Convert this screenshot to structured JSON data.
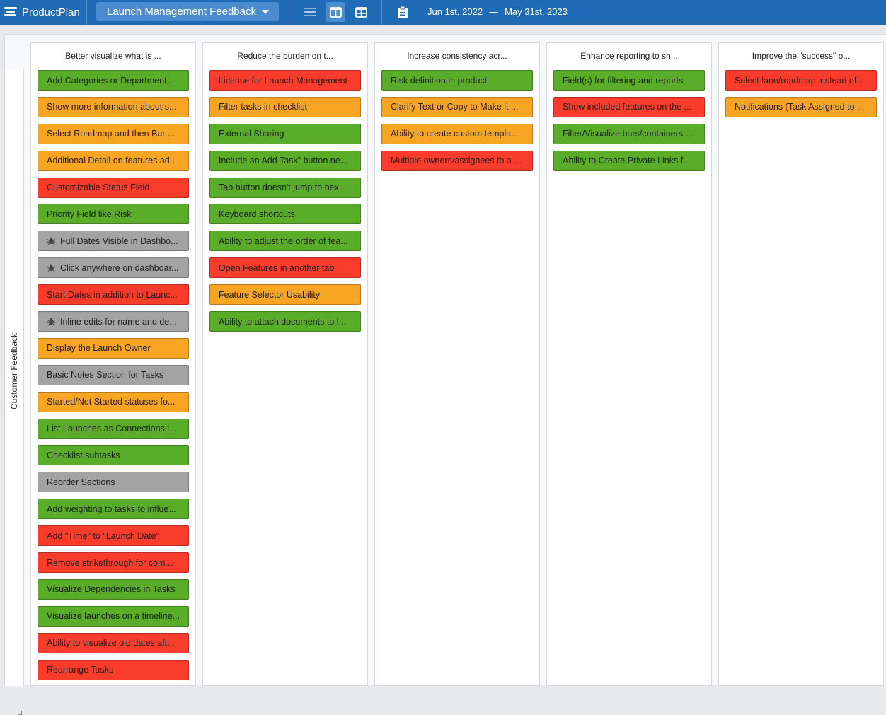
{
  "header": {
    "app_name": "ProductPlan",
    "roadmap_name": "Launch Management Feedback",
    "date_start": "Jun 1st, 2022",
    "date_separator": "—",
    "date_end": "May 31st, 2023",
    "icons": [
      "productplan-logo-icon",
      "dropdown-caret-icon",
      "list-view-icon",
      "board-view-icon",
      "table-view-icon",
      "clipboard-icon"
    ]
  },
  "lane": {
    "label": "Customer Feedback"
  },
  "colors": {
    "green": "#5aad28",
    "orange": "#f9a524",
    "red": "#fa3c2c",
    "gray": "#a3a3a3",
    "header": "#1f6bb5"
  },
  "columns": [
    {
      "title": "Better visualize what is ...",
      "cards": [
        {
          "label": "Add Categories or Department...",
          "color": "green"
        },
        {
          "label": "Show more information about s...",
          "color": "orange"
        },
        {
          "label": "Select Roadmap and then Bar ...",
          "color": "orange"
        },
        {
          "label": "Additional Detail on features ad...",
          "color": "orange"
        },
        {
          "label": "Customizable Status Field",
          "color": "red"
        },
        {
          "label": "Priority Field like Risk",
          "color": "green"
        },
        {
          "label": "Full Dates Visible in Dashbo...",
          "color": "gray",
          "icon": "bug-icon"
        },
        {
          "label": "Click anywhere on dashboar...",
          "color": "gray",
          "icon": "bug-icon"
        },
        {
          "label": "Start Dates in addition to Launc...",
          "color": "red"
        },
        {
          "label": "Inline edits for name and de...",
          "color": "gray",
          "icon": "bug-icon"
        },
        {
          "label": "Display the Launch Owner",
          "color": "orange"
        },
        {
          "label": "Basic Notes Section for Tasks",
          "color": "gray"
        },
        {
          "label": "Started/Not Started statuses fo...",
          "color": "orange"
        },
        {
          "label": "List Launches as Connections i...",
          "color": "green"
        },
        {
          "label": "Checklist subtasks",
          "color": "green"
        },
        {
          "label": "Reorder Sections",
          "color": "gray"
        },
        {
          "label": "Add weighting to tasks to influe...",
          "color": "green"
        },
        {
          "label": "Add \"Time\" to \"Launch Date\"",
          "color": "red"
        },
        {
          "label": "Remove strikethrough for com...",
          "color": "red"
        },
        {
          "label": "Visualize Dependencies in Tasks",
          "color": "green"
        },
        {
          "label": "Visualize launches on a timeline...",
          "color": "green"
        },
        {
          "label": "Ability to visualize old dates aft...",
          "color": "red"
        },
        {
          "label": "Rearrange Tasks",
          "color": "red"
        }
      ]
    },
    {
      "title": "Reduce the burden on t...",
      "cards": [
        {
          "label": "License for Launch Management",
          "color": "red"
        },
        {
          "label": "Filter tasks in checklist",
          "color": "orange"
        },
        {
          "label": "External Sharing",
          "color": "green"
        },
        {
          "label": "Include an Add Task\" button ne...",
          "color": "green"
        },
        {
          "label": "Tab button doesn't jump to nex...",
          "color": "green"
        },
        {
          "label": "Keyboard shortcuts",
          "color": "green"
        },
        {
          "label": "Ability to adjust the order of fea...",
          "color": "green"
        },
        {
          "label": "Open Features in another tab",
          "color": "red"
        },
        {
          "label": "Feature Selector Usability",
          "color": "orange"
        },
        {
          "label": "Ability to attach documents to l...",
          "color": "green"
        }
      ]
    },
    {
      "title": "Increase consistency acr...",
      "cards": [
        {
          "label": "Risk definition in product",
          "color": "green"
        },
        {
          "label": "Clarify Text or Copy to Make it ...",
          "color": "orange"
        },
        {
          "label": "Ability to create custom templa...",
          "color": "orange"
        },
        {
          "label": "Multiple owners/assignees to a ...",
          "color": "red"
        }
      ]
    },
    {
      "title": "Enhance reporting to sh...",
      "cards": [
        {
          "label": "Field(s) for filtering and reports",
          "color": "green"
        },
        {
          "label": "Show included features on the ...",
          "color": "red"
        },
        {
          "label": "Filter/Visualize bars/containers ...",
          "color": "green"
        },
        {
          "label": "Ability to Create Private Links f...",
          "color": "green"
        }
      ]
    },
    {
      "title": "Improve the \"success\" o...",
      "cards": [
        {
          "label": "Select lane/roadmap instead of ...",
          "color": "red"
        },
        {
          "label": "Notifications (Task Assigned to ...",
          "color": "orange"
        }
      ]
    }
  ]
}
